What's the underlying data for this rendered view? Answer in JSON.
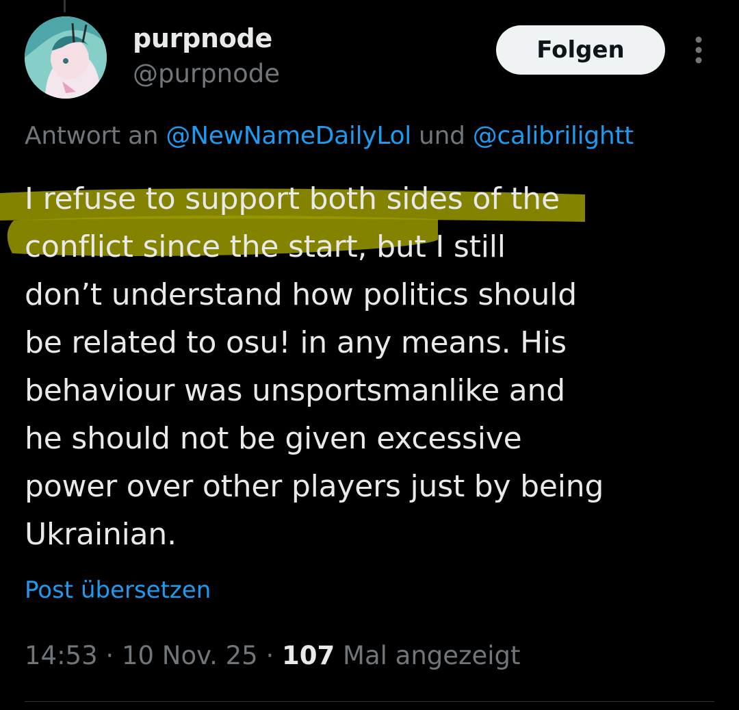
{
  "author": {
    "display_name": "purpnode",
    "handle": "@purpnode"
  },
  "follow_button_label": "Folgen",
  "reply_context": {
    "prefix": "Antwort an ",
    "mention_1": "@NewNameDailyLol",
    "connector": " und ",
    "mention_2": "@calibrilightt"
  },
  "tweet": {
    "lines": [
      "I refuse to support both sides of the",
      "conflict since the start, but I still",
      "don’t understand how politics should",
      "be related to osu! in any means. His",
      "behaviour was unsportsmanlike and",
      "he should not be given excessive",
      "power over other players just by being",
      "Ukrainian."
    ],
    "highlight_color": "#9a9a00"
  },
  "translate_link": "Post übersetzen",
  "meta": {
    "time": "14:53",
    "separator_1": " · ",
    "date": "10 Nov. 25",
    "separator_2": " · ",
    "views_count": "107",
    "views_label": " Mal angezeigt"
  },
  "colors": {
    "background": "#000000",
    "text_primary": "#e7e9ea",
    "text_secondary": "#71767b",
    "link": "#1d9bf0",
    "follow_button_bg": "#eff3f4"
  },
  "icons": {
    "more": "more-vertical-icon"
  }
}
